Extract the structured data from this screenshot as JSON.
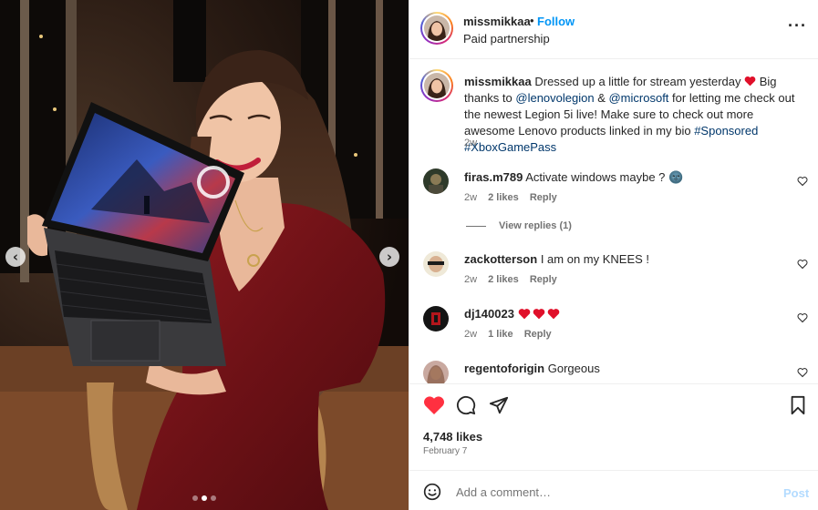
{
  "header": {
    "username": "missmikkaa",
    "separator": "•",
    "follow_label": "Follow",
    "subtitle": "Paid partnership",
    "more_icon": "more-horizontal-icon"
  },
  "caption": {
    "username": "missmikkaa",
    "text_1": "Dressed up a little for stream yesterday ",
    "text_2": " Big thanks to ",
    "mention_1": "@lenovolegion",
    "text_3": " & ",
    "mention_2": "@microsoft",
    "text_4": " for letting me check out the newest Legion 5i live! Make sure to check out more awesome Lenovo products linked in my bio ",
    "hashtag_1": "#Sponsored",
    "hashtag_2": "#XboxGamePass",
    "time": "2w"
  },
  "comments": [
    {
      "username": "firas.m789",
      "text": "Activate windows maybe ? 🌚",
      "time": "2w",
      "likes": "2 likes",
      "reply": "Reply",
      "view_replies": "View replies (1)"
    },
    {
      "username": "zackotterson",
      "text": "I am on my KNEES !",
      "time": "2w",
      "likes": "2 likes",
      "reply": "Reply"
    },
    {
      "username": "dj140023",
      "text": "",
      "time": "2w",
      "likes": "1 like",
      "reply": "Reply"
    },
    {
      "username": "regentoforigin",
      "text": "Gorgeous"
    }
  ],
  "actions": {
    "like_icon": "heart-filled-icon",
    "comment_icon": "comment-icon",
    "share_icon": "paper-plane-icon",
    "save_icon": "bookmark-icon"
  },
  "likes": "4,748 likes",
  "date": "February 7",
  "add_comment": {
    "placeholder": "Add a comment…",
    "post_label": "Post"
  },
  "media": {
    "dots": 3,
    "active_dot": 2
  },
  "colors": {
    "accent_blue": "#0095f6",
    "heart_red": "#ff3040",
    "link": "#00376b",
    "dress": "#7a1418"
  }
}
